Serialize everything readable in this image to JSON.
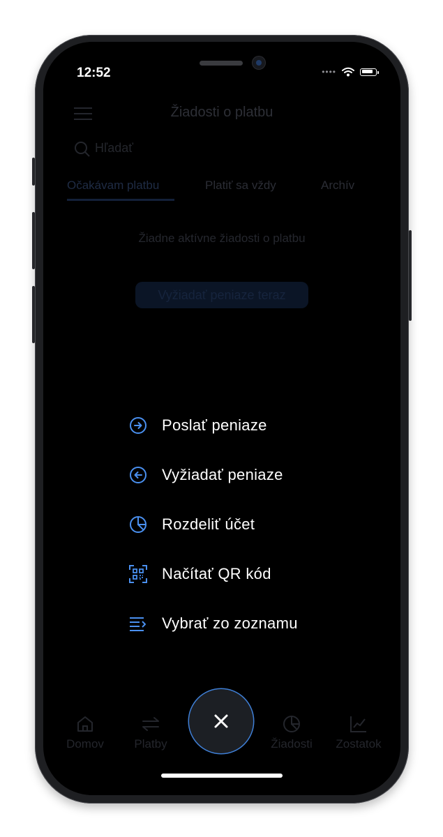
{
  "status_bar": {
    "time": "12:52",
    "signal": "••••"
  },
  "header": {
    "title": "Žiadosti o platbu"
  },
  "search": {
    "placeholder": "Hľadať"
  },
  "tabs": [
    {
      "label": "Očakávam platbu",
      "active": true
    },
    {
      "label": "Platiť sa vždy"
    },
    {
      "label": "Archív"
    }
  ],
  "empty_state": {
    "text": "Žiadne aktívne žiadosti o platbu",
    "button_label": "Vyžiadať peniaze teraz"
  },
  "action_menu": {
    "items": [
      {
        "label": "Poslať peniaze",
        "icon": "arrow-right-circle-icon"
      },
      {
        "label": "Vyžiadať peniaze",
        "icon": "arrow-left-circle-icon"
      },
      {
        "label": "Rozdeliť účet",
        "icon": "pie-chart-icon"
      },
      {
        "label": "Načítať QR kód",
        "icon": "qr-code-icon"
      },
      {
        "label": "Vybrať zo zoznamu",
        "icon": "list-select-icon"
      }
    ]
  },
  "bottom_nav": {
    "items": [
      {
        "label": "Domov",
        "icon": "home-icon"
      },
      {
        "label": "Platby",
        "icon": "transfer-icon"
      },
      {
        "label": "Žiadosti",
        "icon": "pie-chart-icon"
      },
      {
        "label": "Zostatok",
        "icon": "chart-line-icon"
      }
    ],
    "close_button": {
      "icon": "close-icon"
    }
  },
  "colors": {
    "accent": "#4a90f0",
    "background": "#000000",
    "text": "#ffffff",
    "dimmed_text": "#2a2c33"
  }
}
